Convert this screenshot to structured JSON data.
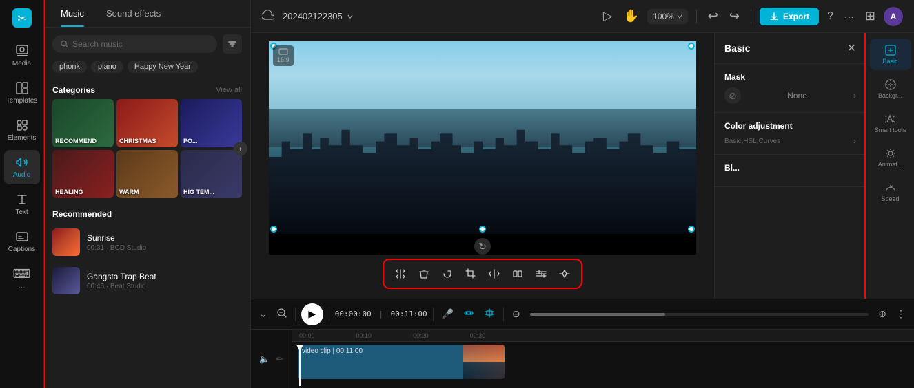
{
  "app": {
    "logo": "✂",
    "project_name": "202402122305",
    "export_label": "Export"
  },
  "left_sidebar": {
    "items": [
      {
        "id": "media",
        "label": "Media",
        "icon": "media"
      },
      {
        "id": "templates",
        "label": "Templates",
        "icon": "templates"
      },
      {
        "id": "elements",
        "label": "Elements",
        "icon": "elements"
      },
      {
        "id": "audio",
        "label": "Audio",
        "icon": "audio",
        "active": true
      },
      {
        "id": "text",
        "label": "Text",
        "icon": "text"
      },
      {
        "id": "captions",
        "label": "Captions",
        "icon": "captions"
      },
      {
        "id": "more",
        "label": "···",
        "icon": "more"
      }
    ]
  },
  "music_panel": {
    "tabs": [
      {
        "id": "music",
        "label": "Music",
        "active": true
      },
      {
        "id": "sound_effects",
        "label": "Sound effects",
        "active": false
      }
    ],
    "search": {
      "placeholder": "Search music"
    },
    "tags": [
      "phonk",
      "piano",
      "Happy New Year"
    ],
    "categories": {
      "title": "Categories",
      "view_all": "View all",
      "items": [
        {
          "id": "recommend",
          "label": "RECOMMEND",
          "color_class": "cat-recommend"
        },
        {
          "id": "christmas",
          "label": "CHRISTMAS",
          "color_class": "cat-christmas"
        },
        {
          "id": "pop",
          "label": "PO...",
          "color_class": "cat-pop"
        },
        {
          "id": "healing",
          "label": "HEALING",
          "color_class": "cat-healing"
        },
        {
          "id": "warm",
          "label": "WARM",
          "color_class": "cat-warm"
        },
        {
          "id": "hightemp",
          "label": "HIG TEM...",
          "color_class": "cat-hight"
        }
      ]
    },
    "recommended": {
      "title": "Recommended",
      "tracks": [
        {
          "id": "sunrise",
          "name": "Sunrise",
          "meta": "00:31 · BCD Studio",
          "thumb_class": "thumb-sunrise"
        },
        {
          "id": "gangsta",
          "name": "Gangsta Trap Beat",
          "meta": "00:45 · Beat Studio",
          "thumb_class": "thumb-gangsta"
        }
      ]
    }
  },
  "top_bar": {
    "project_name": "202402122305",
    "zoom": "100%",
    "undo": "↩",
    "redo": "↪",
    "export": "Export",
    "help": "?",
    "more": "···",
    "layout": "⊞"
  },
  "video_toolbar": {
    "crop_icon": "⬜",
    "stabilize_icon": "⊡",
    "transform_icon": "⟳",
    "more": "···"
  },
  "edit_toolbar": {
    "tools": [
      {
        "id": "split",
        "icon": "⌇",
        "label": "split"
      },
      {
        "id": "delete",
        "icon": "🗑",
        "label": "delete"
      },
      {
        "id": "rotate",
        "icon": "↻",
        "label": "rotate"
      },
      {
        "id": "crop",
        "icon": "⊡",
        "label": "crop"
      },
      {
        "id": "flip",
        "icon": "⇔",
        "label": "flip"
      },
      {
        "id": "mirror",
        "icon": "⊟",
        "label": "mirror"
      },
      {
        "id": "adjust",
        "icon": "≡",
        "label": "adjust"
      },
      {
        "id": "keyframe",
        "icon": "⟡",
        "label": "keyframe"
      }
    ]
  },
  "right_panel": {
    "title": "Basic",
    "sections": {
      "mask": {
        "title": "Mask",
        "value": "None"
      },
      "color_adjustment": {
        "title": "Color adjustment",
        "description": "Basic,HSL,Curves"
      },
      "blend": {
        "title": "Bl..."
      }
    }
  },
  "right_icons": {
    "items": [
      {
        "id": "basic",
        "label": "Basic",
        "active": true
      },
      {
        "id": "background",
        "label": "Backgr...",
        "active": false
      },
      {
        "id": "smart_tools",
        "label": "Smart tools",
        "active": false
      },
      {
        "id": "animate",
        "label": "Animat...",
        "active": false
      },
      {
        "id": "speed",
        "label": "Speed",
        "active": false
      }
    ]
  },
  "timeline": {
    "current_time": "00:00:00",
    "total_time": "00:11:00",
    "time_markers": [
      "00:00",
      "00:10",
      "00:20",
      "00:30"
    ],
    "video_track_label": "video clip | 00:11:00"
  },
  "aspect_ratio": "16:9"
}
